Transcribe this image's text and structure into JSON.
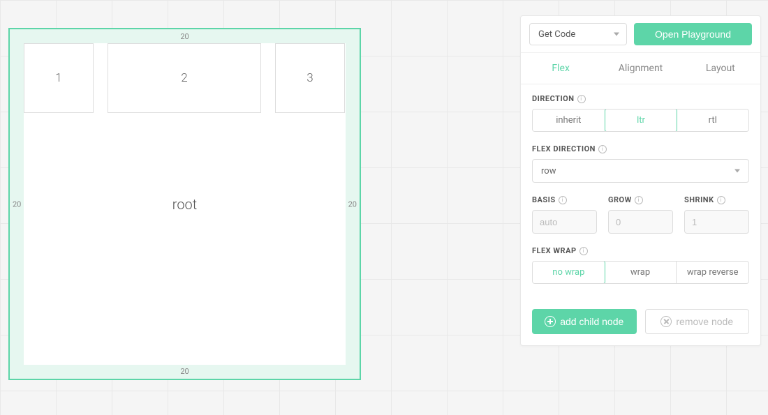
{
  "canvas": {
    "root_label": "root",
    "padding": {
      "top": "20",
      "right": "20",
      "bottom": "20",
      "left": "20"
    },
    "children": [
      {
        "label": "1"
      },
      {
        "label": "2"
      },
      {
        "label": "3"
      }
    ]
  },
  "panel": {
    "header": {
      "get_code_label": "Get Code",
      "open_playground_label": "Open Playground"
    },
    "tabs": [
      {
        "id": "flex",
        "label": "Flex",
        "active": true
      },
      {
        "id": "alignment",
        "label": "Alignment",
        "active": false
      },
      {
        "id": "layout",
        "label": "Layout",
        "active": false
      }
    ],
    "direction": {
      "label": "DIRECTION",
      "options": [
        "inherit",
        "ltr",
        "rtl"
      ],
      "selected": "ltr"
    },
    "flex_direction": {
      "label": "FLEX DIRECTION",
      "value": "row"
    },
    "basis": {
      "label": "BASIS",
      "placeholder": "auto",
      "value": ""
    },
    "grow": {
      "label": "GROW",
      "placeholder": "0",
      "value": ""
    },
    "shrink": {
      "label": "SHRINK",
      "placeholder": "1",
      "value": ""
    },
    "flex_wrap": {
      "label": "FLEX WRAP",
      "options": [
        "no wrap",
        "wrap",
        "wrap reverse"
      ],
      "selected": "no wrap"
    },
    "footer": {
      "add_child_label": "add child node",
      "remove_node_label": "remove node"
    }
  }
}
